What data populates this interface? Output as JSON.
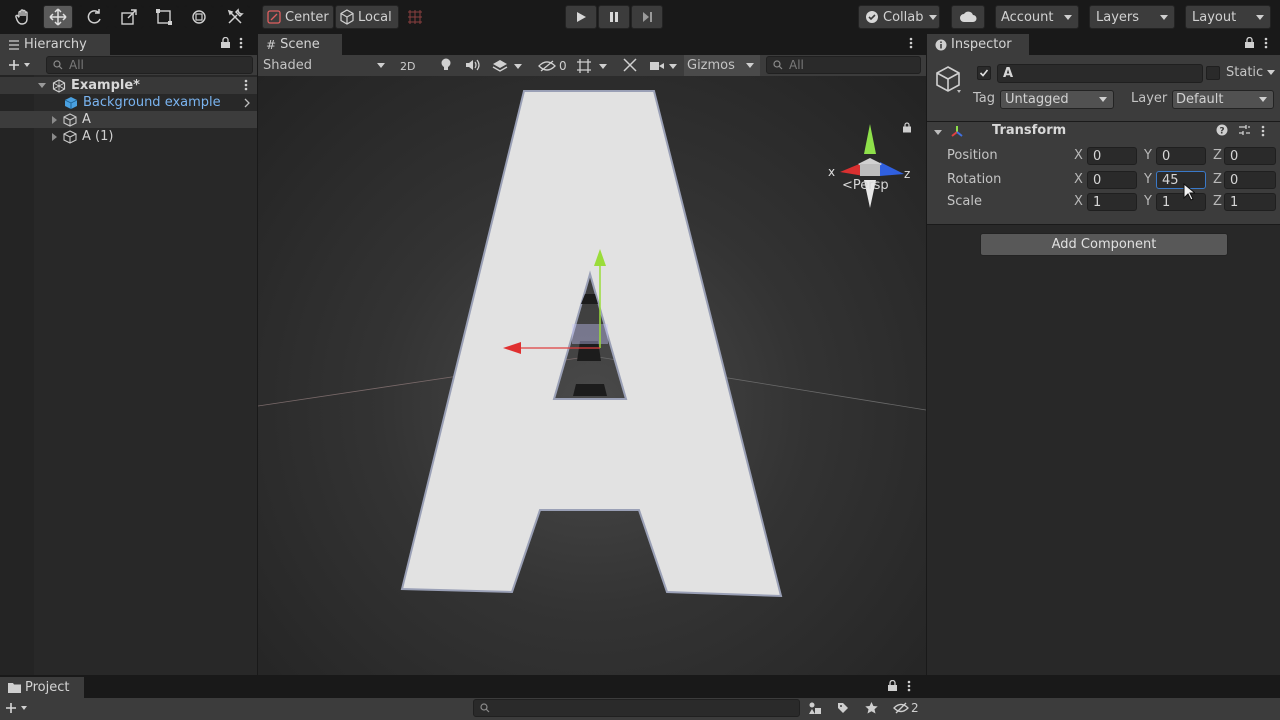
{
  "toolbar": {
    "pivot_label": "Center",
    "space_label": "Local",
    "collab_label": "Collab",
    "account_label": "Account",
    "layers_label": "Layers",
    "layout_label": "Layout"
  },
  "hierarchy": {
    "tab_label": "Hierarchy",
    "search_placeholder": "All",
    "items": [
      {
        "label": "Example*"
      },
      {
        "label": "Background example"
      },
      {
        "label": "A"
      },
      {
        "label": "A (1)"
      }
    ]
  },
  "scene": {
    "tab_label": "Scene",
    "shading_mode": "Shaded",
    "mode_2d": "2D",
    "hidden_count": "0",
    "gizmos_label": "Gizmos",
    "search_placeholder": "All",
    "persp_label": "<Persp",
    "gizmo_x": "x",
    "gizmo_z": "z",
    "letter": "A"
  },
  "inspector": {
    "tab_label": "Inspector",
    "object_name": "A",
    "static_label": "Static",
    "tag_label": "Tag",
    "tag_value": "Untagged",
    "layer_label": "Layer",
    "layer_value": "Default",
    "component_title": "Transform",
    "add_component_label": "Add Component",
    "rows": [
      {
        "label": "Position",
        "x": "0",
        "y": "0",
        "z": "0"
      },
      {
        "label": "Rotation",
        "x": "0",
        "y": "45",
        "z": "0"
      },
      {
        "label": "Scale",
        "x": "1",
        "y": "1",
        "z": "1"
      }
    ],
    "axis_x": "X",
    "axis_y": "Y",
    "axis_z": "Z"
  },
  "project": {
    "tab_label": "Project",
    "hidden_count": "2"
  }
}
